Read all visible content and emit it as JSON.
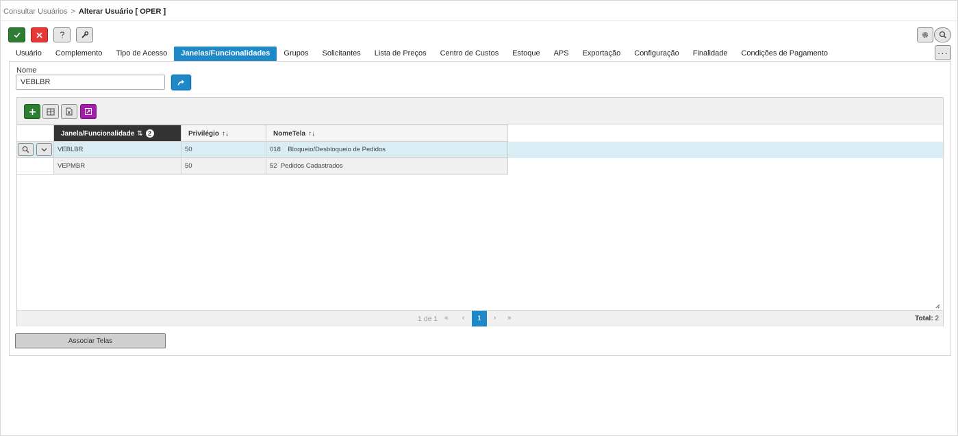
{
  "breadcrumb": {
    "parent": "Consultar Usuários",
    "separator": ">",
    "current": "Alterar Usuário [ OPER ]"
  },
  "toolbar": {
    "buttons": [
      {
        "name": "confirm",
        "icon": "check-icon",
        "color": "#2e7d32"
      },
      {
        "name": "cancel",
        "icon": "close-icon",
        "color": "#e53935"
      },
      {
        "name": "help",
        "icon": "question-icon"
      },
      {
        "name": "tools",
        "icon": "wrench-icon"
      }
    ],
    "right_icons": [
      "gear-icon",
      "search-icon"
    ],
    "more_label": "···"
  },
  "tabs": [
    {
      "label": "Usuário",
      "active": false
    },
    {
      "label": "Complemento",
      "active": false
    },
    {
      "label": "Tipo de Acesso",
      "active": false
    },
    {
      "label": "Janelas/Funcionalidades",
      "active": true
    },
    {
      "label": "Grupos",
      "active": false
    },
    {
      "label": "Solicitantes",
      "active": false
    },
    {
      "label": "Lista de Preços",
      "active": false
    },
    {
      "label": "Centro de Custos",
      "active": false
    },
    {
      "label": "Estoque",
      "active": false
    },
    {
      "label": "APS",
      "active": false
    },
    {
      "label": "Exportação",
      "active": false
    },
    {
      "label": "Configuração",
      "active": false
    },
    {
      "label": "Finalidade",
      "active": false
    },
    {
      "label": "Condições de Pagamento",
      "active": false
    }
  ],
  "form": {
    "nome_label": "Nome",
    "nome_value": "VEBLBR"
  },
  "grid": {
    "toolbar_icons": [
      "plus-icon",
      "columns-icon",
      "excel-icon",
      "expand-icon"
    ],
    "columns": [
      {
        "label": "Janela/Funcionalidade",
        "sort_icon": "⇅",
        "badge": "2",
        "sorted": true
      },
      {
        "label": "Privilégio",
        "sort_icon": "↑↓",
        "sorted": false
      },
      {
        "label": "NomeTela",
        "sort_icon": "↑↓",
        "sorted": false
      }
    ],
    "rows": [
      {
        "janela": "VEBLBR",
        "privilegio": "50",
        "nome_tela": "018    Bloqueio/Desbloqueio de Pedidos",
        "selected": true
      },
      {
        "janela": "VEPMBR",
        "privilegio": "50",
        "nome_tela": "52  Pedidos Cadastrados",
        "selected": false
      }
    ],
    "pagination": {
      "info": "1 de 1",
      "first": "«",
      "prev": "‹",
      "current": "1",
      "next": "›",
      "last": "»",
      "total_label": "Total:",
      "total_value": "2"
    }
  },
  "actions": {
    "associar_label": "Associar Telas"
  },
  "colors": {
    "accent": "#1e88c8",
    "selected_row": "#d9edf5",
    "success": "#2e7d32",
    "danger": "#e53935",
    "export": "#a020a8"
  }
}
